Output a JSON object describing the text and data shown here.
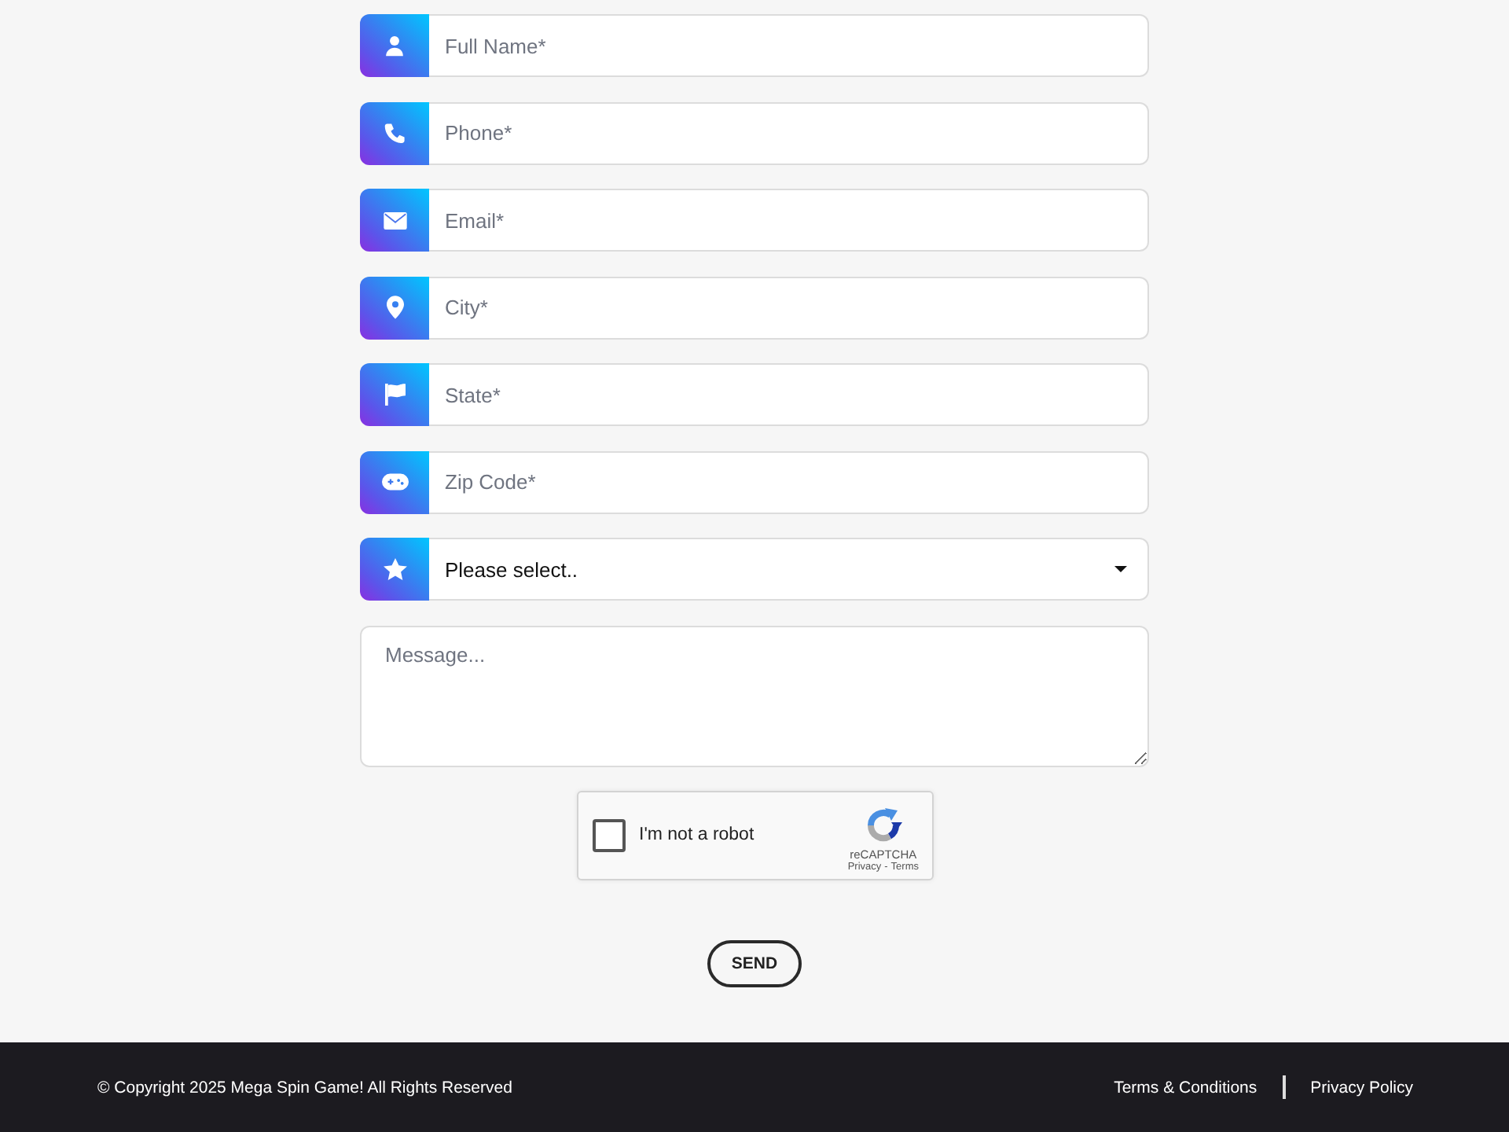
{
  "form": {
    "fields": [
      {
        "kind": "input",
        "placeholder": "Full Name*"
      },
      {
        "kind": "input",
        "placeholder": "Phone*"
      },
      {
        "kind": "input",
        "placeholder": "Email*"
      },
      {
        "kind": "input",
        "placeholder": "City*"
      },
      {
        "kind": "input",
        "placeholder": "State*"
      },
      {
        "kind": "input",
        "placeholder": "Zip Code*"
      },
      {
        "kind": "select",
        "value": "Please select.."
      }
    ],
    "message": {
      "placeholder": "Message..."
    },
    "captcha": {
      "checked": false,
      "label": "I'm not a robot",
      "brand": "reCAPTCHA",
      "links": [
        "Privacy",
        "Terms"
      ],
      "separator": "-"
    },
    "submit": "SEND"
  },
  "footer": {
    "copyright": "© Copyright 2025 Mega Spin Game! All Rights Reserved",
    "links": [
      "Terms & Conditions",
      "Privacy Policy"
    ]
  }
}
